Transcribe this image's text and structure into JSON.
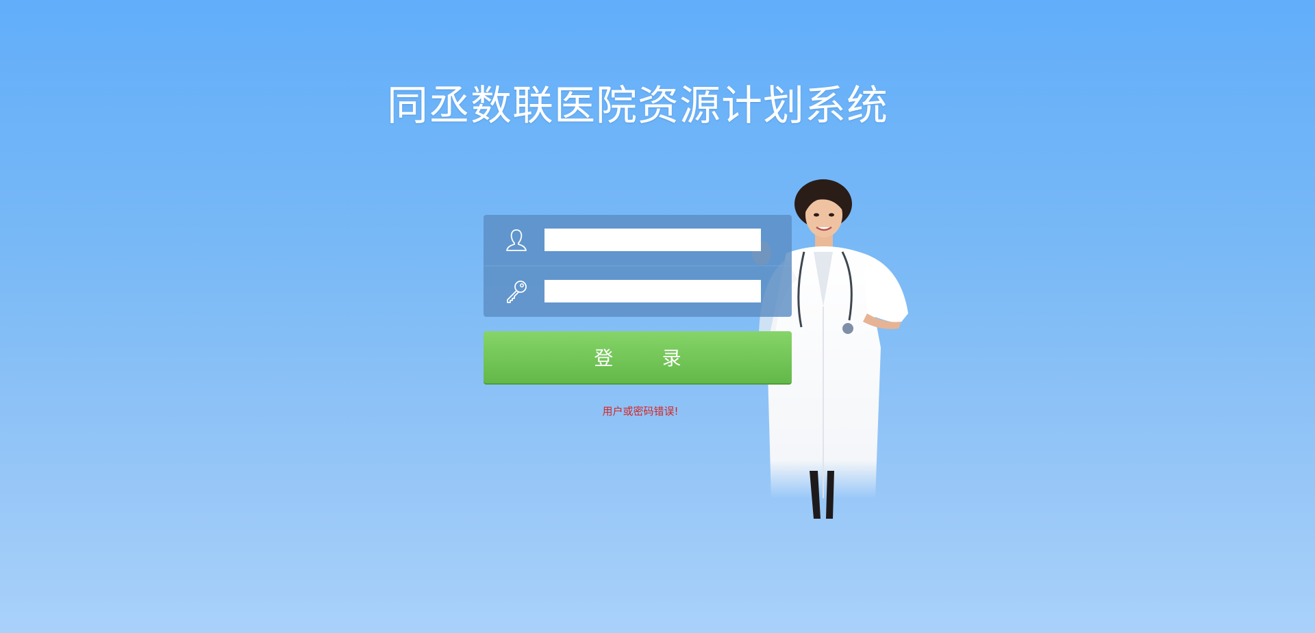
{
  "page": {
    "title": "同丞数联医院资源计划系统",
    "background_top": "#62aefa",
    "background_bottom": "#a9d1fa"
  },
  "login": {
    "username_icon": "user-icon",
    "username_value": "",
    "password_icon": "key-icon",
    "password_value": "",
    "button_label": "登        录",
    "button_color": "#74c658",
    "error_message": "用户或密码错误!",
    "error_color": "#d62424"
  },
  "illustration": {
    "icon": "doctor-illustration"
  }
}
